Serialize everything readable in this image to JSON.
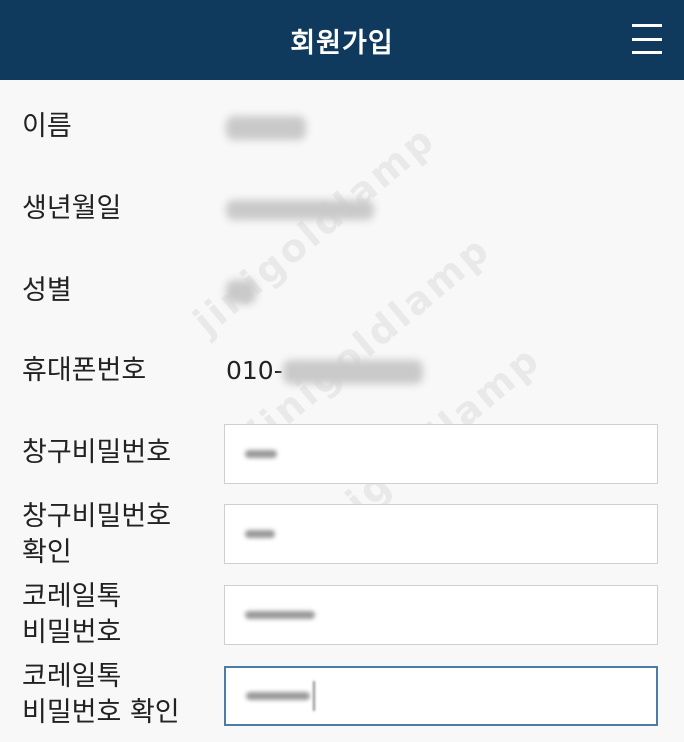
{
  "header": {
    "title": "회원가입",
    "menu_icon": "hamburger-menu-icon"
  },
  "fields": {
    "name_label": "이름",
    "birth_label": "생년월일",
    "gender_label": "성별",
    "phone_label": "휴대폰번호",
    "phone_prefix": "010-",
    "window_pw_label": "창구비밀번호",
    "window_pw_confirm_label_line1": "창구비밀번호",
    "window_pw_confirm_label_line2": "확인",
    "korail_pw_label_line1": "코레일톡",
    "korail_pw_label_line2": "비밀번호",
    "korail_pw_confirm_label_line1": "코레일톡",
    "korail_pw_confirm_label_line2": "비밀번호 확인"
  },
  "watermark": {
    "text": "jinigoldlamp"
  },
  "colors": {
    "header_bg": "#0f3a5e",
    "focus_border": "#4a7ea8"
  }
}
